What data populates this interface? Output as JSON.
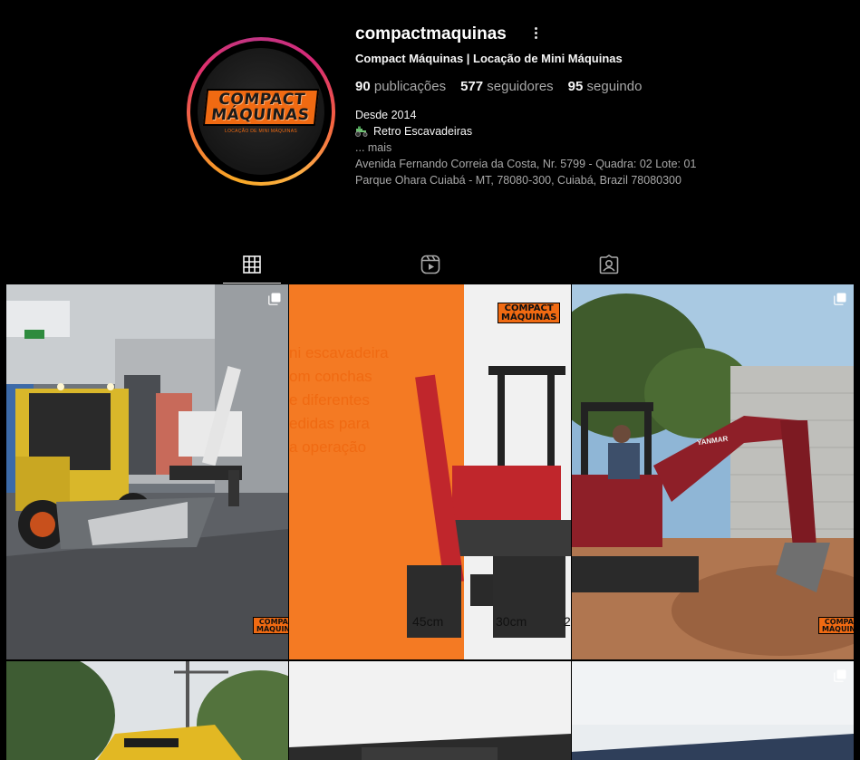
{
  "profile": {
    "username": "compactmaquinas",
    "full_name": "Compact Máquinas | Locação de Mini Máquinas",
    "stats": {
      "posts_count": "90",
      "posts_label": "publicações",
      "followers_count": "577",
      "followers_label": "seguidores",
      "following_count": "95",
      "following_label": "seguindo"
    },
    "bio": {
      "line1": "Desde 2014",
      "line2": "Retro Escavadeiras",
      "more": "... mais",
      "address": "Avenida Fernando Correia da Costa, Nr. 5799 - Quadra: 02 Lote: 01 Parque Ohara Cuiabá - MT, 78080-300, Cuiabá, Brazil 78080300"
    },
    "avatar_logo": {
      "line1": "COMPACT",
      "line2": "MÁQUINAS",
      "subtitle": "LOCAÇÃO DE MINI MÁQUINAS"
    }
  },
  "tabs": [
    {
      "name": "posts",
      "icon": "grid-icon",
      "active": true
    },
    {
      "name": "reels",
      "icon": "reels-icon",
      "active": false
    },
    {
      "name": "tagged",
      "icon": "tagged-icon",
      "active": false
    }
  ],
  "posts": {
    "watermark": {
      "line1": "COMPACT",
      "line2": "MÁQUINAS"
    },
    "post2_text": "ni escavadeira\nom conchas\ne diferentes\nedidas para\na operação",
    "post2_dims": [
      "45cm",
      "30cm",
      "2"
    ],
    "post3_brand": "YANMAR"
  },
  "colors": {
    "background": "#000000",
    "brand_orange": "#f06a12",
    "text_primary": "#f5f5f5",
    "text_secondary": "#a8a8a8"
  }
}
